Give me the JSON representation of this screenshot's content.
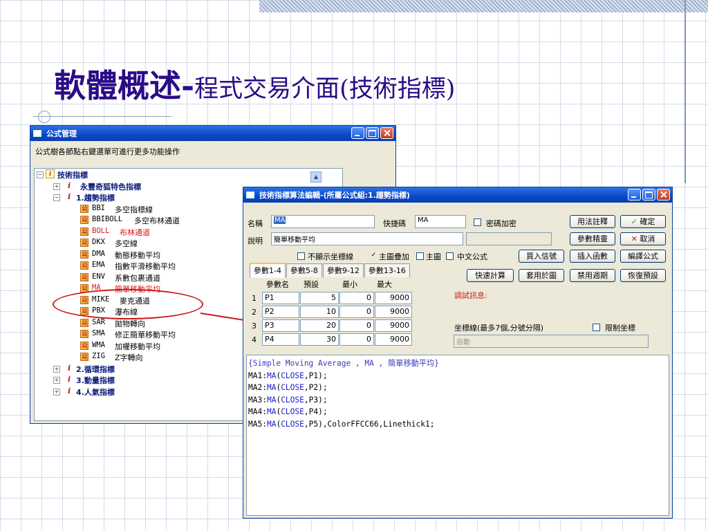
{
  "slide": {
    "title_main": "軟體概述-",
    "title_sub": "程式交易介面(技術指標)"
  },
  "formula_manager": {
    "title": "公式管理",
    "hint": "公式樹各節點右鍵選單可進行更多功能操作",
    "tree": {
      "root": "技術指標",
      "group0": "永豐奇狐特色指標",
      "group1": "1.趨勢指標",
      "items": [
        {
          "code": "BBI",
          "name": "多空指標線",
          "color": "#000000"
        },
        {
          "code": "BBIBOLL",
          "name": "多空布林通道",
          "color": "#000000"
        },
        {
          "code": "BOLL",
          "name": "布林通道",
          "color": "#d91515"
        },
        {
          "code": "DKX",
          "name": "多空線",
          "color": "#000000"
        },
        {
          "code": "DMA",
          "name": "動態移動平均",
          "color": "#000000"
        },
        {
          "code": "EMA",
          "name": "指數平滑移動平均",
          "color": "#000000"
        },
        {
          "code": "ENV",
          "name": "系數包裹通道",
          "color": "#000000"
        },
        {
          "code": "MA",
          "name": "簡單移動平均",
          "color": "#d91515"
        },
        {
          "code": "MIKE",
          "name": "麥克通道",
          "color": "#000000"
        },
        {
          "code": "PBX",
          "name": "瀑布線",
          "color": "#000000"
        },
        {
          "code": "SAR",
          "name": "拋物轉向",
          "color": "#000000"
        },
        {
          "code": "SMA",
          "name": "修正簡單移動平均",
          "color": "#000000"
        },
        {
          "code": "WMA",
          "name": "加權移動平均",
          "color": "#000000"
        },
        {
          "code": "ZIG",
          "name": "Z字轉向",
          "color": "#000000"
        }
      ],
      "group2": "2.循環指標",
      "group3": "3.動量指標",
      "group4": "4.人氣指標"
    }
  },
  "editor": {
    "title": "技術指標算法編輯-(所屬公式組:1.趨勢指標)",
    "name_label": "名稱",
    "name_value": "MA",
    "hotkey_label": "快捷碼",
    "hotkey_value": "MA",
    "password_label": "密碼加密",
    "desc_label": "說明",
    "desc_value": "簡單移動平均",
    "chk_hide_axis": "不顯示坐標線",
    "chk_main_overlay": "主圖疊加",
    "chk_main": "主圖",
    "chk_chinese": "中文公式",
    "btn_usage": "用法註釋",
    "btn_ok": "確定",
    "btn_param_wizard": "參數精靈",
    "btn_cancel": "取消",
    "btn_buy_sell": "買入信號",
    "btn_insert_func": "插入函數",
    "btn_compile": "編譯公式",
    "btn_quick_calc": "快速計算",
    "btn_apply_chart": "套用於圖",
    "btn_disable_period": "禁用週期",
    "btn_restore_default": "恢復預設",
    "tabs": [
      "參數1-4",
      "參數5-8",
      "參數9-12",
      "參數13-16"
    ],
    "param_headers": [
      "參數名",
      "預設",
      "最小",
      "最大"
    ],
    "params": [
      {
        "idx": "1",
        "name": "P1",
        "default": "5",
        "min": "0",
        "max": "9000"
      },
      {
        "idx": "2",
        "name": "P2",
        "default": "10",
        "min": "0",
        "max": "9000"
      },
      {
        "idx": "3",
        "name": "P3",
        "default": "20",
        "min": "0",
        "max": "9000"
      },
      {
        "idx": "4",
        "name": "P4",
        "default": "30",
        "min": "0",
        "max": "9000"
      }
    ],
    "debug_label": "調試訊息:",
    "axis_label": "坐標線(最多7個,分號分隔)",
    "limit_axis_label": "限制坐標",
    "axis_value": "自動",
    "code": {
      "comment": "{Simple Moving Average , MA , 簡單移動平均}",
      "lines": [
        {
          "prefix": "MA1:",
          "fn": "MA",
          "open": "(",
          "arg": "CLOSE",
          "rest": ",P1);"
        },
        {
          "prefix": "MA2:",
          "fn": "MA",
          "open": "(",
          "arg": "CLOSE",
          "rest": ",P2);"
        },
        {
          "prefix": "MA3:",
          "fn": "MA",
          "open": "(",
          "arg": "CLOSE",
          "rest": ",P3);"
        },
        {
          "prefix": "MA4:",
          "fn": "MA",
          "open": "(",
          "arg": "CLOSE",
          "rest": ",P4);"
        },
        {
          "prefix": "MA5:",
          "fn": "MA",
          "open": "(",
          "arg": "CLOSE",
          "rest": ",P5),ColorFFCC66,Linethick1;"
        }
      ]
    }
  }
}
